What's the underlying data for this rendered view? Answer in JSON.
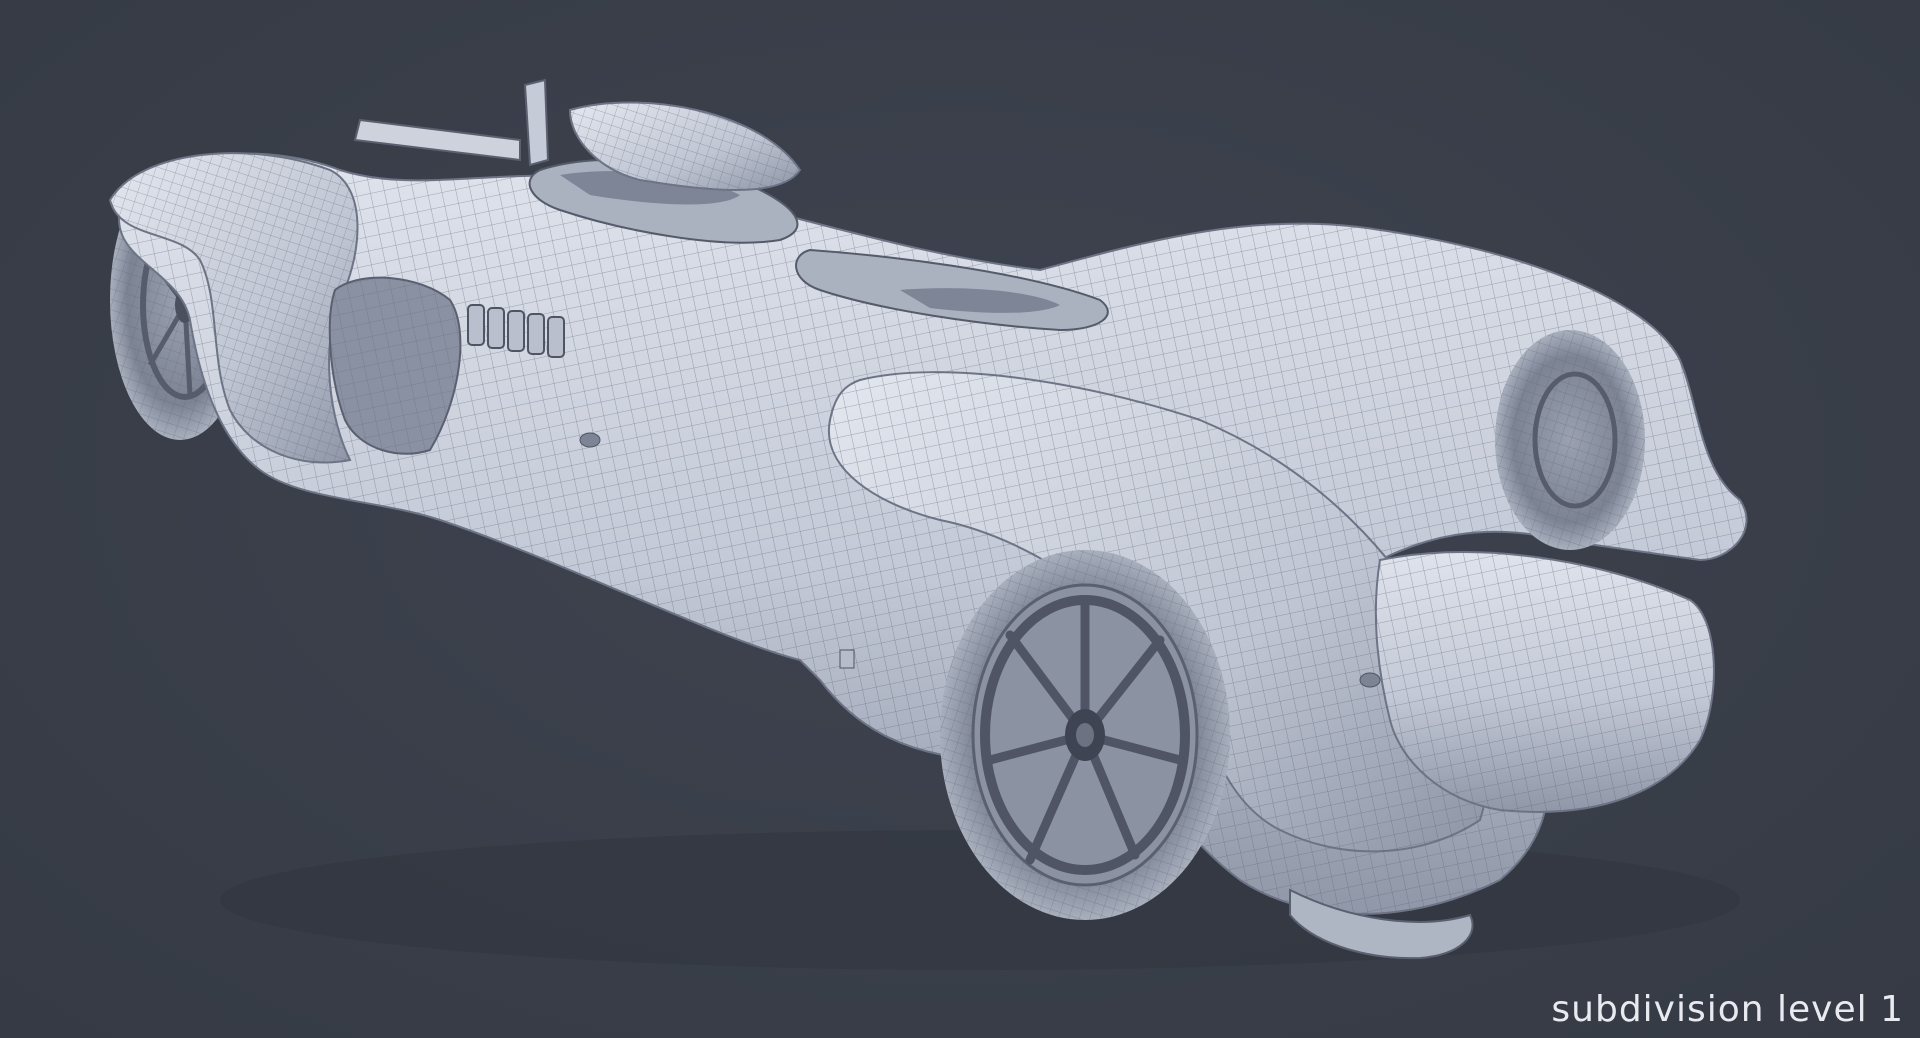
{
  "caption": "subdivision level 1",
  "colors": {
    "background": "#3a3f4a",
    "body_surface": "#c9cfdb",
    "body_shadow": "#8f97a8",
    "wireframe": "#5a6070",
    "wheel": "#6a7080",
    "caption_text": "#e8eaef"
  }
}
